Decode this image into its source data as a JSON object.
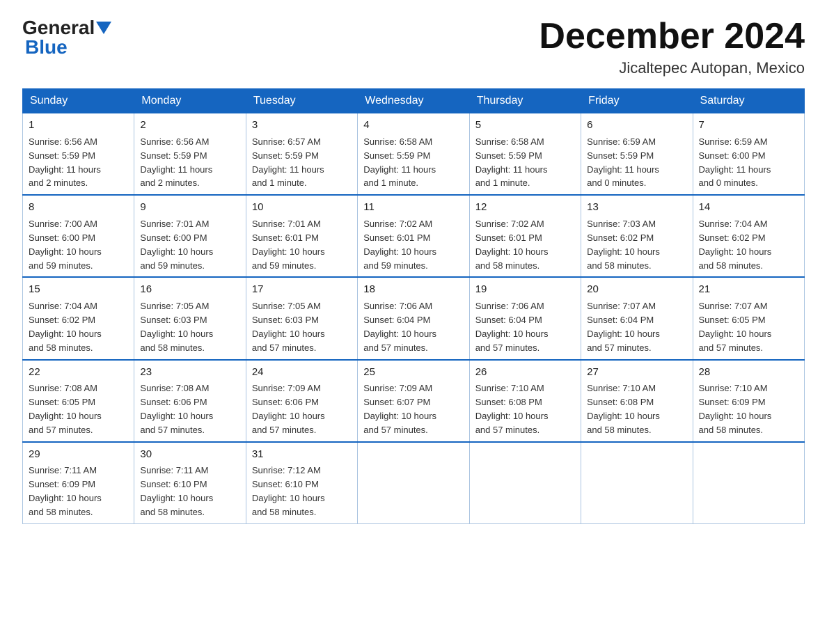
{
  "logo": {
    "general": "General",
    "blue": "Blue"
  },
  "title": "December 2024",
  "location": "Jicaltepec Autopan, Mexico",
  "days_of_week": [
    "Sunday",
    "Monday",
    "Tuesday",
    "Wednesday",
    "Thursday",
    "Friday",
    "Saturday"
  ],
  "weeks": [
    [
      {
        "day": "1",
        "sunrise": "6:56 AM",
        "sunset": "5:59 PM",
        "daylight": "11 hours and 2 minutes."
      },
      {
        "day": "2",
        "sunrise": "6:56 AM",
        "sunset": "5:59 PM",
        "daylight": "11 hours and 2 minutes."
      },
      {
        "day": "3",
        "sunrise": "6:57 AM",
        "sunset": "5:59 PM",
        "daylight": "11 hours and 1 minute."
      },
      {
        "day": "4",
        "sunrise": "6:58 AM",
        "sunset": "5:59 PM",
        "daylight": "11 hours and 1 minute."
      },
      {
        "day": "5",
        "sunrise": "6:58 AM",
        "sunset": "5:59 PM",
        "daylight": "11 hours and 1 minute."
      },
      {
        "day": "6",
        "sunrise": "6:59 AM",
        "sunset": "5:59 PM",
        "daylight": "11 hours and 0 minutes."
      },
      {
        "day": "7",
        "sunrise": "6:59 AM",
        "sunset": "6:00 PM",
        "daylight": "11 hours and 0 minutes."
      }
    ],
    [
      {
        "day": "8",
        "sunrise": "7:00 AM",
        "sunset": "6:00 PM",
        "daylight": "10 hours and 59 minutes."
      },
      {
        "day": "9",
        "sunrise": "7:01 AM",
        "sunset": "6:00 PM",
        "daylight": "10 hours and 59 minutes."
      },
      {
        "day": "10",
        "sunrise": "7:01 AM",
        "sunset": "6:01 PM",
        "daylight": "10 hours and 59 minutes."
      },
      {
        "day": "11",
        "sunrise": "7:02 AM",
        "sunset": "6:01 PM",
        "daylight": "10 hours and 59 minutes."
      },
      {
        "day": "12",
        "sunrise": "7:02 AM",
        "sunset": "6:01 PM",
        "daylight": "10 hours and 58 minutes."
      },
      {
        "day": "13",
        "sunrise": "7:03 AM",
        "sunset": "6:02 PM",
        "daylight": "10 hours and 58 minutes."
      },
      {
        "day": "14",
        "sunrise": "7:04 AM",
        "sunset": "6:02 PM",
        "daylight": "10 hours and 58 minutes."
      }
    ],
    [
      {
        "day": "15",
        "sunrise": "7:04 AM",
        "sunset": "6:02 PM",
        "daylight": "10 hours and 58 minutes."
      },
      {
        "day": "16",
        "sunrise": "7:05 AM",
        "sunset": "6:03 PM",
        "daylight": "10 hours and 58 minutes."
      },
      {
        "day": "17",
        "sunrise": "7:05 AM",
        "sunset": "6:03 PM",
        "daylight": "10 hours and 57 minutes."
      },
      {
        "day": "18",
        "sunrise": "7:06 AM",
        "sunset": "6:04 PM",
        "daylight": "10 hours and 57 minutes."
      },
      {
        "day": "19",
        "sunrise": "7:06 AM",
        "sunset": "6:04 PM",
        "daylight": "10 hours and 57 minutes."
      },
      {
        "day": "20",
        "sunrise": "7:07 AM",
        "sunset": "6:04 PM",
        "daylight": "10 hours and 57 minutes."
      },
      {
        "day": "21",
        "sunrise": "7:07 AM",
        "sunset": "6:05 PM",
        "daylight": "10 hours and 57 minutes."
      }
    ],
    [
      {
        "day": "22",
        "sunrise": "7:08 AM",
        "sunset": "6:05 PM",
        "daylight": "10 hours and 57 minutes."
      },
      {
        "day": "23",
        "sunrise": "7:08 AM",
        "sunset": "6:06 PM",
        "daylight": "10 hours and 57 minutes."
      },
      {
        "day": "24",
        "sunrise": "7:09 AM",
        "sunset": "6:06 PM",
        "daylight": "10 hours and 57 minutes."
      },
      {
        "day": "25",
        "sunrise": "7:09 AM",
        "sunset": "6:07 PM",
        "daylight": "10 hours and 57 minutes."
      },
      {
        "day": "26",
        "sunrise": "7:10 AM",
        "sunset": "6:08 PM",
        "daylight": "10 hours and 57 minutes."
      },
      {
        "day": "27",
        "sunrise": "7:10 AM",
        "sunset": "6:08 PM",
        "daylight": "10 hours and 58 minutes."
      },
      {
        "day": "28",
        "sunrise": "7:10 AM",
        "sunset": "6:09 PM",
        "daylight": "10 hours and 58 minutes."
      }
    ],
    [
      {
        "day": "29",
        "sunrise": "7:11 AM",
        "sunset": "6:09 PM",
        "daylight": "10 hours and 58 minutes."
      },
      {
        "day": "30",
        "sunrise": "7:11 AM",
        "sunset": "6:10 PM",
        "daylight": "10 hours and 58 minutes."
      },
      {
        "day": "31",
        "sunrise": "7:12 AM",
        "sunset": "6:10 PM",
        "daylight": "10 hours and 58 minutes."
      },
      null,
      null,
      null,
      null
    ]
  ],
  "cell_labels": {
    "sunrise": "Sunrise:",
    "sunset": "Sunset:",
    "daylight": "Daylight:"
  }
}
